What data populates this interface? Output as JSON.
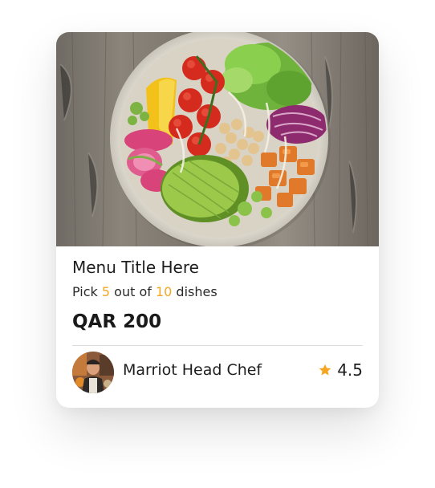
{
  "card": {
    "title": "Menu Title Here",
    "subtitle": {
      "prefix": "Pick ",
      "picked": "5",
      "middle": " out of ",
      "total": "10",
      "suffix": " dishes"
    },
    "price": "QAR 200",
    "chef": {
      "name": "Marriot Head Chef",
      "avatar_icon": "chef-portrait"
    },
    "rating": {
      "value": "4.5",
      "icon": "star-icon"
    },
    "image_icon": "salad-bowl-photo"
  },
  "colors": {
    "accent": "#f5a623",
    "text": "#1e1e1e",
    "divider": "#dcdcdc"
  }
}
